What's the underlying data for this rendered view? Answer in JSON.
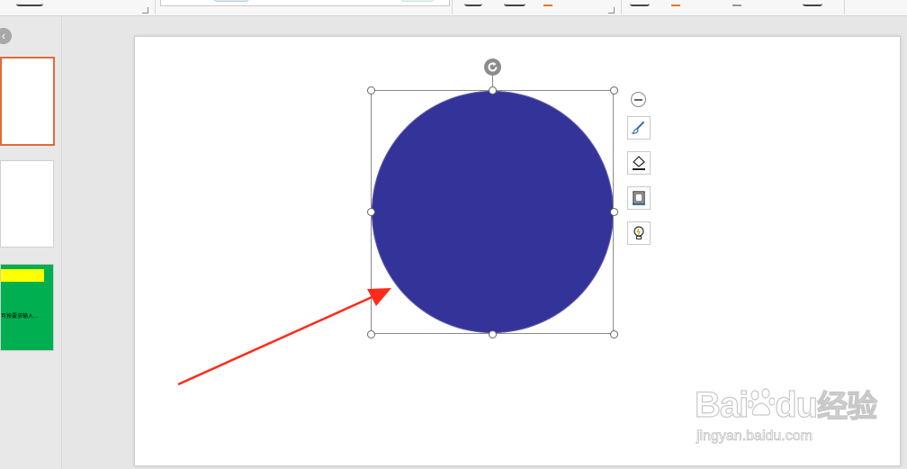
{
  "ribbon": {
    "gallery_colors": [
      "#3a3a3a",
      "#dbe9f5",
      "#6a6ab0",
      "#3a3a3a",
      "#e8f4f1"
    ]
  },
  "slides": [
    {
      "active": true
    },
    {
      "active": false
    },
    {
      "active": false,
      "text": "可按要求输入…"
    }
  ],
  "shape": {
    "fill": "#333399",
    "type": "circle"
  },
  "float_toolbar": {
    "items": [
      "collapse-icon",
      "brush-icon",
      "fill-bucket-icon",
      "outline-icon",
      "lightbulb-icon"
    ]
  },
  "annotation": {
    "arrow_color": "#ff2a1a"
  },
  "watermark": {
    "brand_latin": "Bai",
    "brand_du": "du",
    "brand_cn": "经验",
    "url": "jingyan.baidu.com"
  }
}
